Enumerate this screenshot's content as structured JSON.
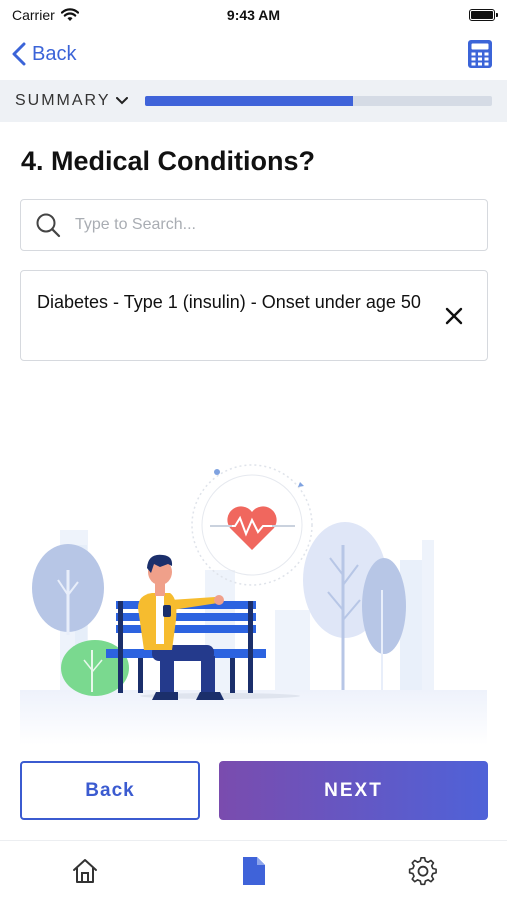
{
  "status_bar": {
    "carrier": "Carrier",
    "time": "9:43 AM"
  },
  "nav": {
    "back_label": "Back",
    "back_icon": "chevron-left-icon",
    "calculator_icon": "calculator-icon"
  },
  "summary": {
    "label": "SUMMARY",
    "progress": 0.6
  },
  "question": {
    "title": "4. Medical Conditions?",
    "search_placeholder": "Type to Search...",
    "search_value": "",
    "selected": [
      {
        "label": "Diabetes - Type 1 (insulin) - Onset under age 50"
      }
    ]
  },
  "buttons": {
    "back_label": "Back",
    "next_label": "NEXT"
  },
  "tabs": [
    {
      "icon": "home-icon",
      "active": false
    },
    {
      "icon": "document-icon",
      "active": true
    },
    {
      "icon": "gear-icon",
      "active": false
    }
  ],
  "colors": {
    "accent": "#3B5BD0",
    "next_gradient_start": "#7A4CAE",
    "next_gradient_end": "#4F62D8",
    "heart": "#F0675E"
  }
}
